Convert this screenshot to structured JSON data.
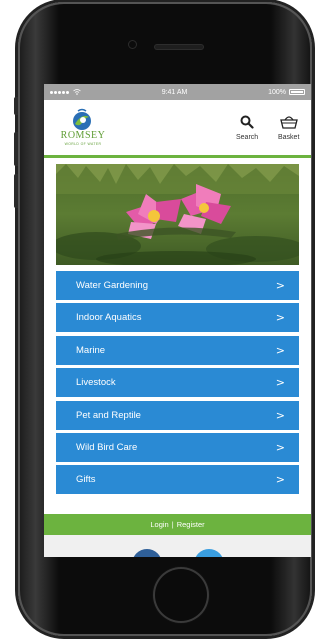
{
  "status_bar": {
    "carrier_dots": "•••••",
    "time": "9:41 AM",
    "battery": "100%"
  },
  "header": {
    "logo_name": "ROMSEY",
    "logo_tagline": "WORLD OF WATER",
    "search_label": "Search",
    "basket_label": "Basket"
  },
  "menu": {
    "items": [
      {
        "label": "Water Gardening"
      },
      {
        "label": "Indoor Aquatics"
      },
      {
        "label": "Marine"
      },
      {
        "label": "Livestock"
      },
      {
        "label": "Pet and Reptile"
      },
      {
        "label": "Wild Bird Care"
      },
      {
        "label": "Gifts"
      }
    ],
    "chevron": ">"
  },
  "auth": {
    "login": "Login",
    "separator": "|",
    "register": "Register"
  },
  "colors": {
    "menu_blue": "#2a8ad4",
    "brand_green": "#6cb33f",
    "status_gray": "#a2a2a2"
  },
  "icons": [
    "search-icon",
    "basket-icon",
    "wifi-icon",
    "battery-icon"
  ]
}
